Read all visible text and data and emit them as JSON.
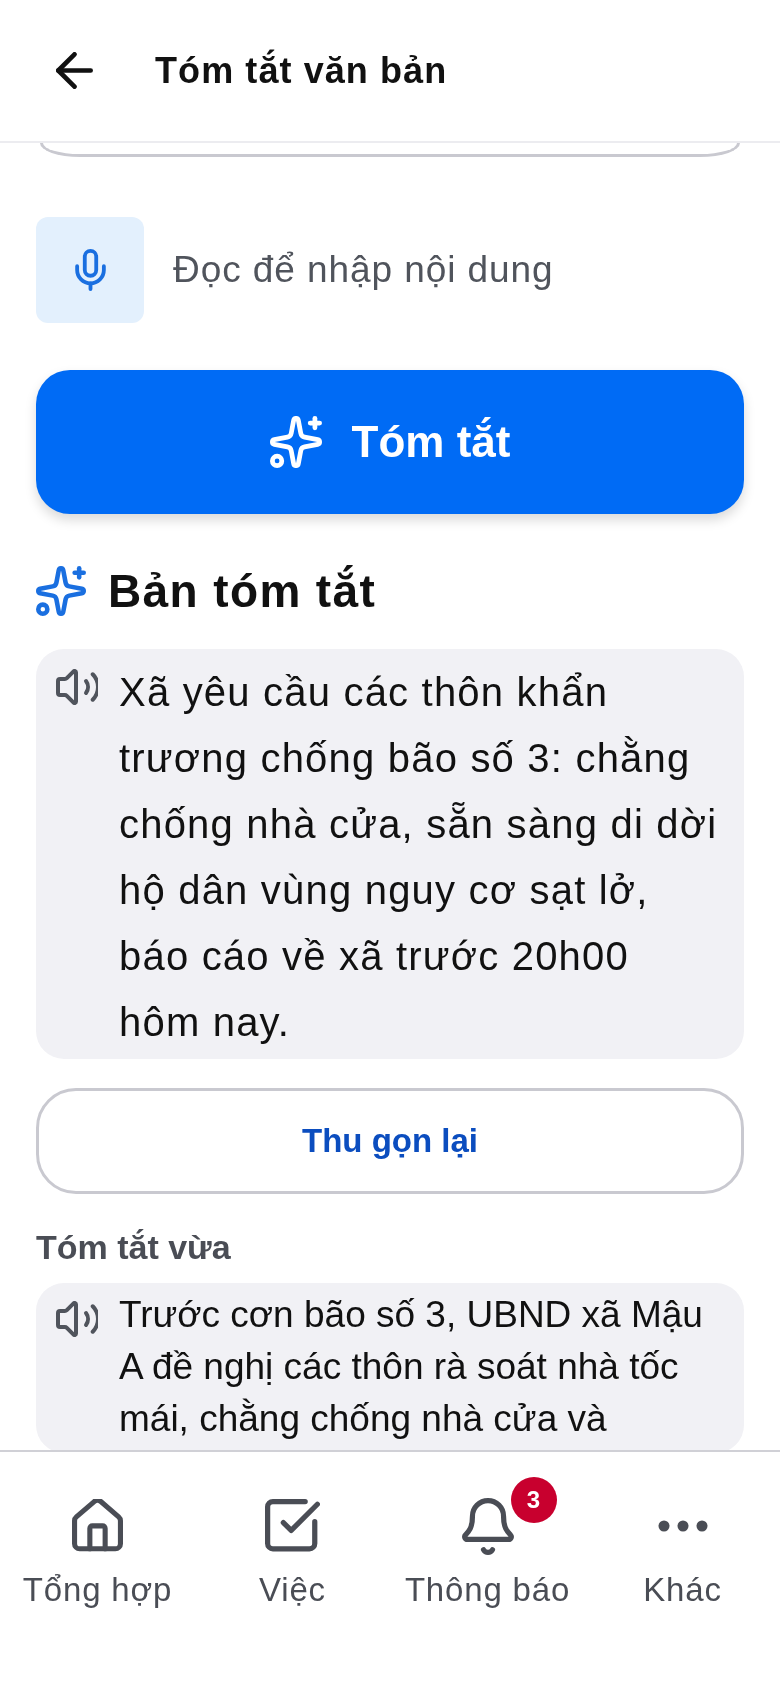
{
  "header": {
    "title": "Tóm tắt văn bản"
  },
  "voice_input": {
    "label": "Đọc để nhập nội dung"
  },
  "summarize_button": {
    "label": "Tóm tắt"
  },
  "summary": {
    "title": "Bản tóm tắt",
    "text": "Xã yêu cầu các thôn khẩn trương chống bão số 3: chằng chống nhà cửa, sẵn sàng di dời hộ dân vùng nguy cơ sạt lở, báo cáo về xã trước 20h00 hôm nay."
  },
  "collapse_button": {
    "label": "Thu gọn lại"
  },
  "recent": {
    "title": "Tóm tắt vừa",
    "items": [
      {
        "text": "Trước cơn bão số 3, UBND xã Mậu A đề nghị các thôn rà soát nhà tốc mái, chằng chống nhà cửa và"
      }
    ]
  },
  "bottom_nav": {
    "items": [
      {
        "label": "Tổng hợp"
      },
      {
        "label": "Việc"
      },
      {
        "label": "Thông báo",
        "badge": "3"
      },
      {
        "label": "Khác"
      }
    ]
  }
}
